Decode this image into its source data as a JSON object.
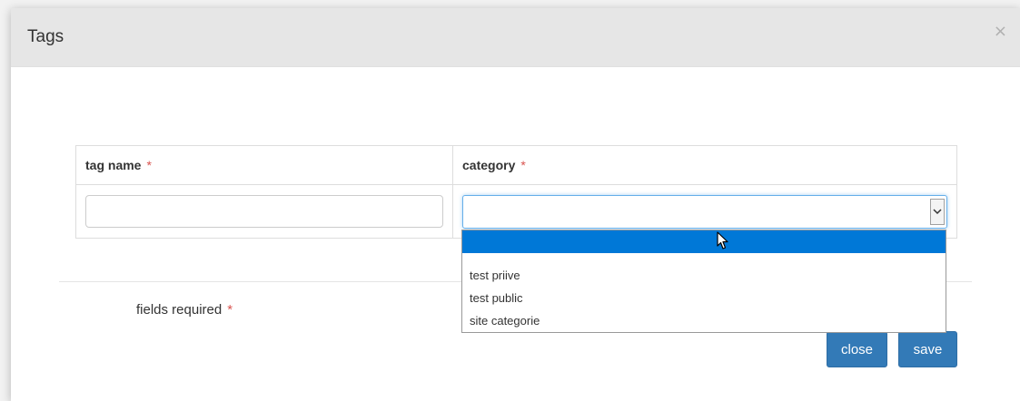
{
  "modal": {
    "title": "Tags",
    "close_glyph": "×"
  },
  "table": {
    "headers": [
      {
        "label": "tag name",
        "required_mark": "*"
      },
      {
        "label": "category",
        "required_mark": "*"
      }
    ],
    "tag_name_value": "",
    "category_value": ""
  },
  "dropdown": {
    "options": [
      "",
      "test priive",
      "test public",
      "site categorie"
    ],
    "highlighted_index": 0
  },
  "footer": {
    "fields_required_label": "fields required",
    "required_mark": "*",
    "close_label": "close",
    "save_label": "save"
  },
  "icons": {
    "close": "close-x-icon",
    "select_arrow": "chevron-down-icon",
    "cursor": "mouse-pointer-icon"
  },
  "colors": {
    "header_bg": "#e6e6e6",
    "primary_button": "#337ab7",
    "required": "#d9534f",
    "highlight": "#0078d7",
    "focus_border": "#66afe9"
  }
}
